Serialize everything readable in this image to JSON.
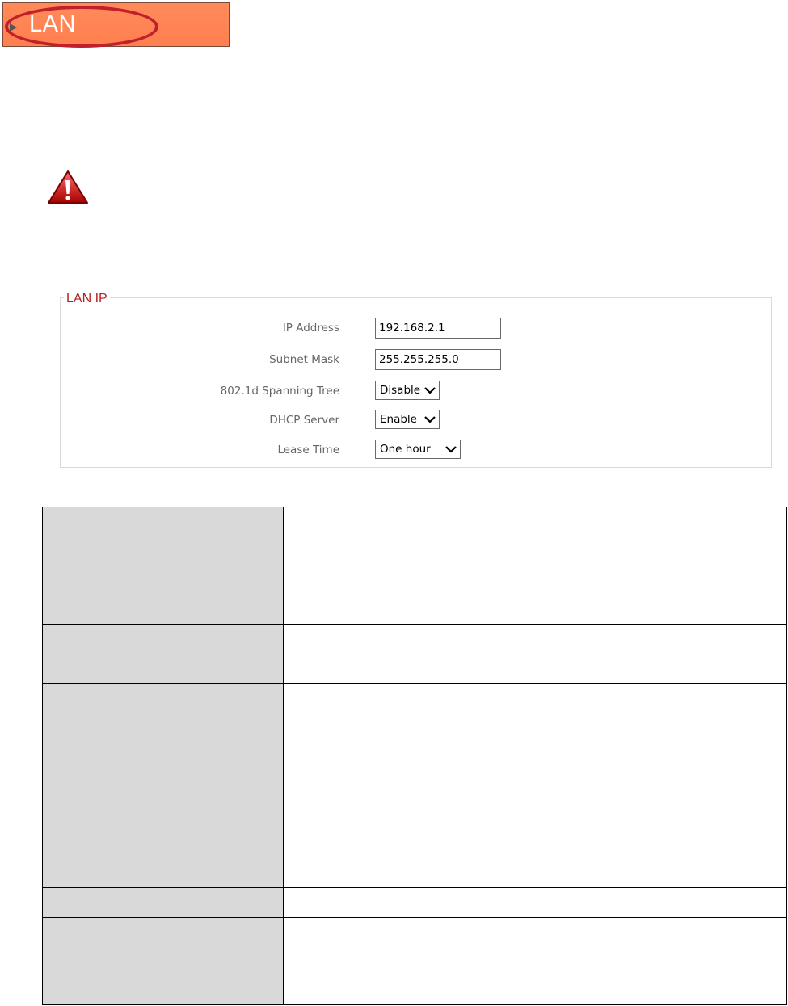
{
  "header": {
    "tab_label": "LAN"
  },
  "panel": {
    "legend": "LAN IP",
    "fields": {
      "ip_address": {
        "label": "IP Address",
        "value": "192.168.2.1"
      },
      "subnet_mask": {
        "label": "Subnet Mask",
        "value": "255.255.255.0"
      },
      "spanning_tree": {
        "label": "802.1d Spanning Tree",
        "value": "Disable"
      },
      "dhcp_server": {
        "label": "DHCP Server",
        "value": "Enable"
      },
      "lease_time": {
        "label": "Lease Time",
        "value": "One hour"
      }
    }
  },
  "icons": {
    "warning": "warning-triangle-icon",
    "tab_arrow": "triangle-right-icon",
    "dropdown": "chevron-down-icon"
  },
  "colors": {
    "tab_bg": "#ff7f50",
    "highlight_circle": "#c0202a",
    "legend": "#b22222",
    "table_key_bg": "#d9d9d9"
  }
}
